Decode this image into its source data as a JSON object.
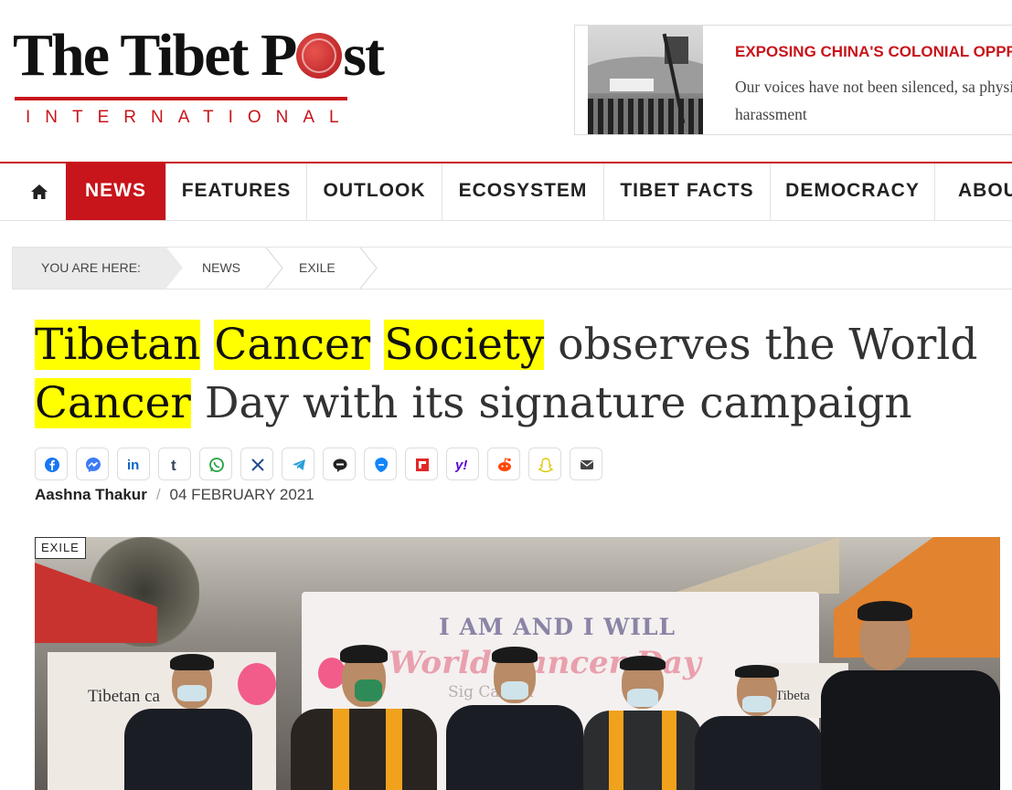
{
  "site": {
    "logo_title_a": "The Tibet P",
    "logo_title_b": "st",
    "logo_subtitle": "INTERNATIONAL"
  },
  "banner": {
    "title": "EXPOSING CHINA'S COLONIAL OPPRES",
    "text": "Our voices have not been silenced, sa physical harassment"
  },
  "nav": {
    "items": [
      {
        "label": "NEWS",
        "active": true
      },
      {
        "label": "FEATURES"
      },
      {
        "label": "OUTLOOK"
      },
      {
        "label": "ECOSYSTEM"
      },
      {
        "label": "TIBET FACTS"
      },
      {
        "label": "DEMOCRACY"
      },
      {
        "label": "ABOUT"
      }
    ],
    "home_icon": "home-icon"
  },
  "breadcrumb": {
    "lead": "YOU ARE HERE:",
    "items": [
      "NEWS",
      "EXILE"
    ]
  },
  "article": {
    "headline_parts": [
      "Tibetan",
      "Cancer",
      "Society",
      "observes the World",
      "Cancer",
      "Day with its signature campaign"
    ],
    "author": "Aashna Thakur",
    "date": "04 FEBRUARY 2021",
    "category": "EXILE"
  },
  "share_icons": [
    "facebook-icon",
    "messenger-icon",
    "linkedin-icon",
    "tumblr-icon",
    "whatsapp-icon",
    "x-icon",
    "telegram-icon",
    "line-icon",
    "bluesky-icon",
    "flipboard-icon",
    "yahoo-icon",
    "reddit-icon",
    "snapchat-icon",
    "email-icon"
  ],
  "colors": {
    "accent": "#c8141b",
    "highlight": "#ffff00"
  },
  "photo": {
    "board_title": "I AM AND I WILL",
    "board_sub": "World Cancer Day",
    "board_small": "Sig   Campa",
    "sign_left_eng": "Tibetan ca",
    "sign_right_eng": "Tibeta"
  }
}
